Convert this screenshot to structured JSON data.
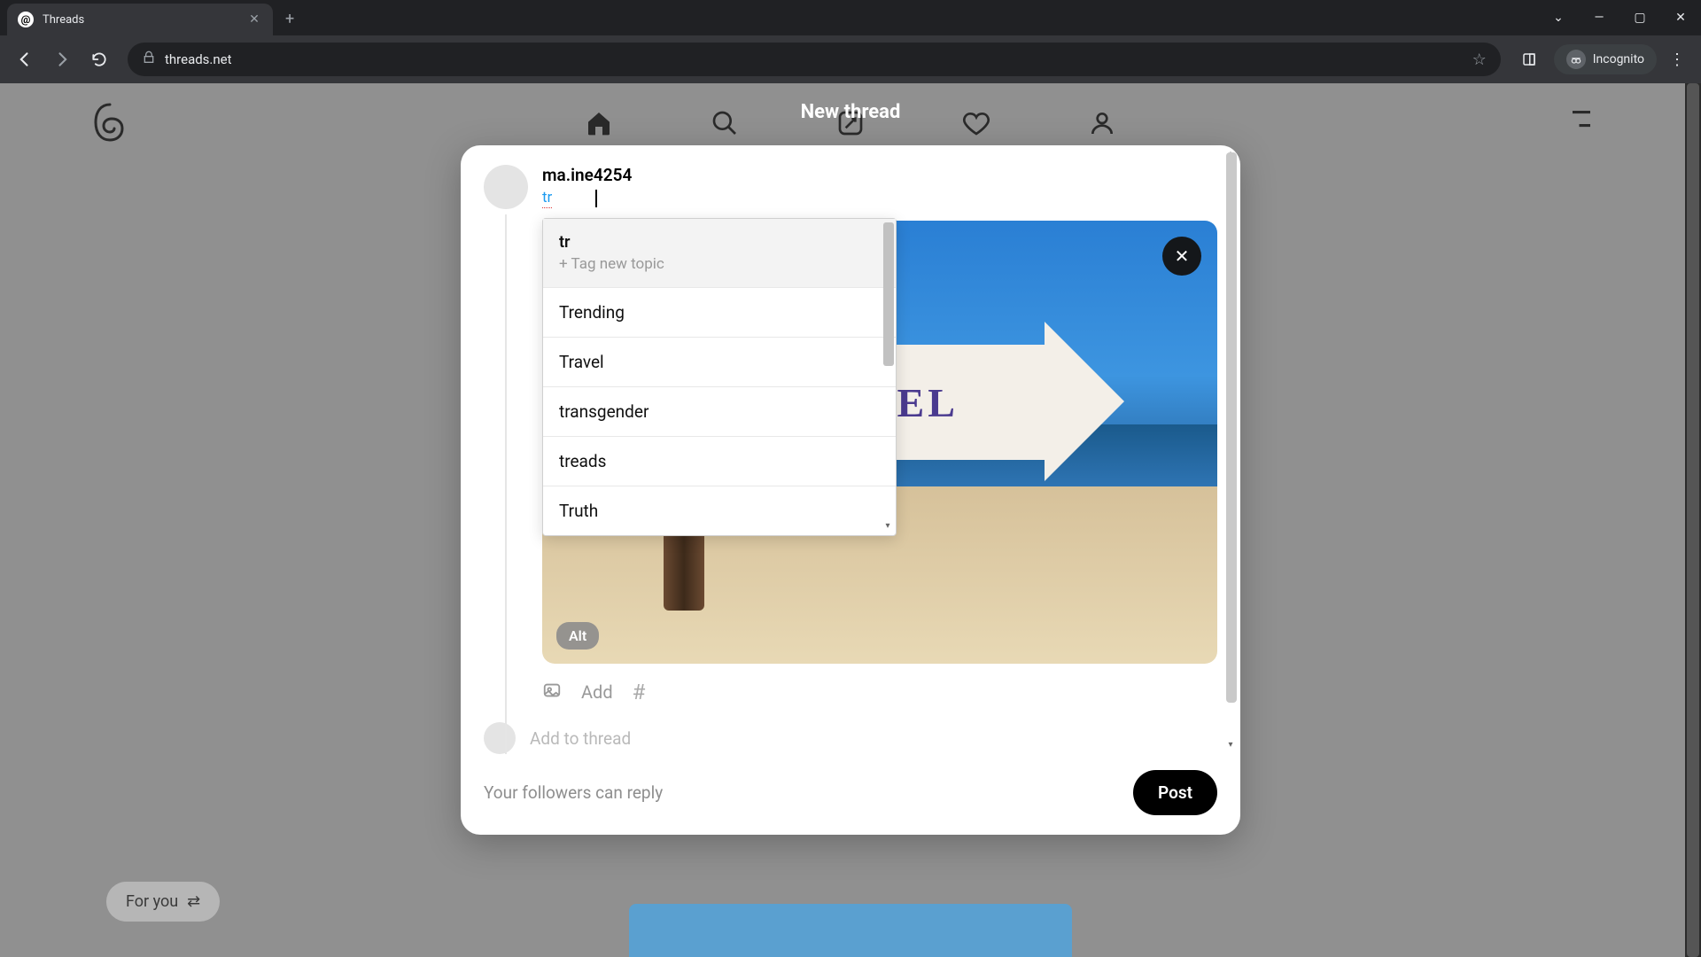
{
  "browser": {
    "tab_title": "Threads",
    "url": "threads.net",
    "incognito_label": "Incognito"
  },
  "header": {
    "modal_title": "New thread"
  },
  "compose": {
    "username": "ma.ine4254",
    "topic_typed": "tr",
    "add_label": "Add",
    "add_to_thread": "Add to thread",
    "alt_badge": "Alt",
    "image_sign_text": "RAVEL"
  },
  "topic_suggestions": {
    "query": "tr",
    "tag_new_label": "+ Tag new topic",
    "items": [
      "Trending",
      "Travel",
      "transgender",
      "treads",
      "Truth"
    ]
  },
  "footer": {
    "reply_scope": "Your followers can reply",
    "post_label": "Post"
  },
  "feed": {
    "for_you_label": "For you"
  }
}
